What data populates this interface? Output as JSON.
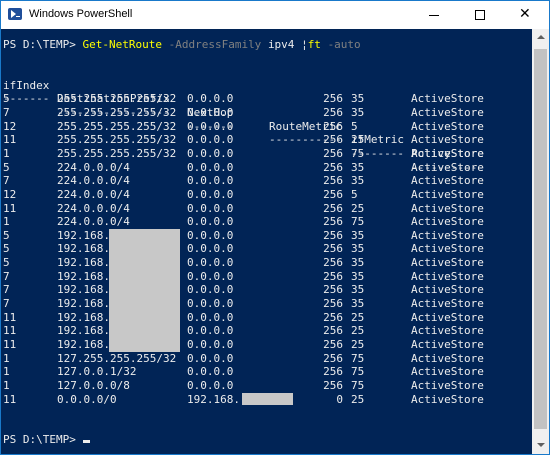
{
  "window": {
    "title": "Windows PowerShell",
    "buttons": {
      "minimize": "minimize",
      "maximize": "maximize",
      "close": "✕"
    }
  },
  "console": {
    "prompt1": "PS D:\\TEMP> ",
    "command": {
      "cmdlet": "Get-NetRoute",
      "param": "-AddressFamily",
      "value": "ipv4",
      "pipe": "¦",
      "format": "ft",
      "format_param": "-auto"
    },
    "headers": [
      "ifIndex",
      "DestinationPrefix",
      "NextHop",
      "RouteMetric",
      "ifMetric",
      "PolicyStore"
    ],
    "underlines": [
      "-------",
      "-----------------",
      "-------",
      "-----------",
      "--------",
      "-----------"
    ],
    "rows": [
      [
        "5",
        "255.255.255.255/32",
        "0.0.0.0",
        "256",
        "35",
        "ActiveStore"
      ],
      [
        "7",
        "255.255.255.255/32",
        "0.0.0.0",
        "256",
        "35",
        "ActiveStore"
      ],
      [
        "12",
        "255.255.255.255/32",
        "0.0.0.0",
        "256",
        "5",
        "ActiveStore"
      ],
      [
        "11",
        "255.255.255.255/32",
        "0.0.0.0",
        "256",
        "25",
        "ActiveStore"
      ],
      [
        "1",
        "255.255.255.255/32",
        "0.0.0.0",
        "256",
        "75",
        "ActiveStore"
      ],
      [
        "5",
        "224.0.0.0/4",
        "0.0.0.0",
        "256",
        "35",
        "ActiveStore"
      ],
      [
        "7",
        "224.0.0.0/4",
        "0.0.0.0",
        "256",
        "35",
        "ActiveStore"
      ],
      [
        "12",
        "224.0.0.0/4",
        "0.0.0.0",
        "256",
        "5",
        "ActiveStore"
      ],
      [
        "11",
        "224.0.0.0/4",
        "0.0.0.0",
        "256",
        "25",
        "ActiveStore"
      ],
      [
        "1",
        "224.0.0.0/4",
        "0.0.0.0",
        "256",
        "75",
        "ActiveStore"
      ],
      [
        "5",
        "192.168.",
        "0.0.0.0",
        "256",
        "35",
        "ActiveStore"
      ],
      [
        "5",
        "192.168.",
        "0.0.0.0",
        "256",
        "35",
        "ActiveStore"
      ],
      [
        "5",
        "192.168.",
        "0.0.0.0",
        "256",
        "35",
        "ActiveStore"
      ],
      [
        "7",
        "192.168.",
        "0.0.0.0",
        "256",
        "35",
        "ActiveStore"
      ],
      [
        "7",
        "192.168.",
        "0.0.0.0",
        "256",
        "35",
        "ActiveStore"
      ],
      [
        "7",
        "192.168.",
        "0.0.0.0",
        "256",
        "35",
        "ActiveStore"
      ],
      [
        "11",
        "192.168.",
        "0.0.0.0",
        "256",
        "25",
        "ActiveStore"
      ],
      [
        "11",
        "192.168.",
        "0.0.0.0",
        "256",
        "25",
        "ActiveStore"
      ],
      [
        "11",
        "192.168.",
        "0.0.0.0",
        "256",
        "25",
        "ActiveStore"
      ],
      [
        "1",
        "127.255.255.255/32",
        "0.0.0.0",
        "256",
        "75",
        "ActiveStore"
      ],
      [
        "1",
        "127.0.0.1/32",
        "0.0.0.0",
        "256",
        "75",
        "ActiveStore"
      ],
      [
        "1",
        "127.0.0.0/8",
        "0.0.0.0",
        "256",
        "75",
        "ActiveStore"
      ],
      [
        "11",
        "0.0.0.0/0",
        "192.168.",
        "0",
        "25",
        "ActiveStore"
      ]
    ],
    "prompt2": "PS D:\\TEMP> "
  },
  "colors": {
    "console_bg": "#012456",
    "text": "#ededed",
    "cmdlet": "#ffff00",
    "parameter": "#808080",
    "redaction": "#c8c8c8"
  }
}
